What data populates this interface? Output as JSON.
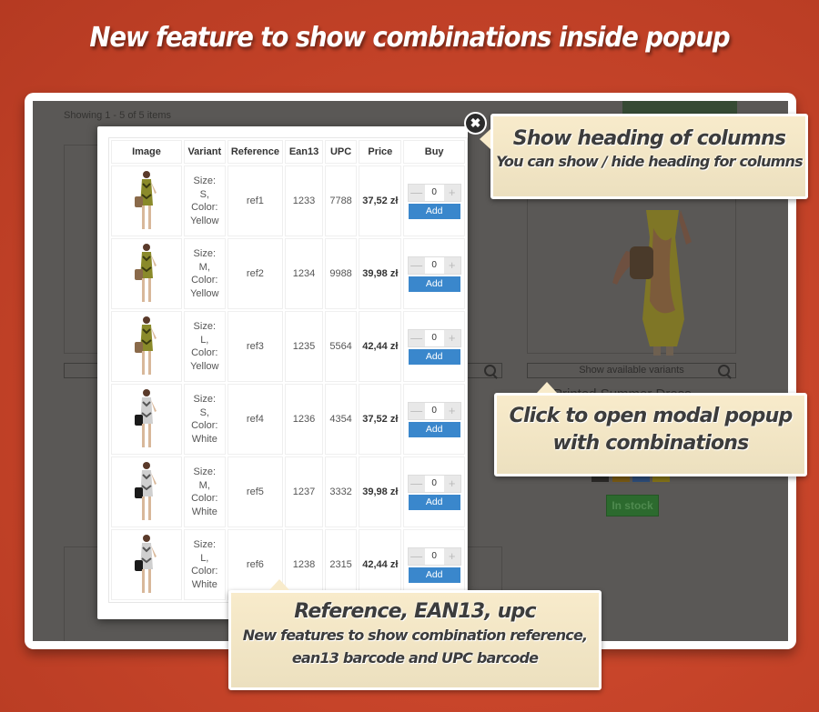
{
  "headline": "New feature to show combinations inside popup",
  "shop": {
    "showing_text": "Showing 1 - 5 of 5 items",
    "show_variants_label": "Show available variants",
    "product_name_partial": "Printed Summer Dress",
    "in_stock_label": "In stock",
    "swatch_colors": [
      "#2b2a28",
      "#7a5a14",
      "#2d4d7a",
      "#857417"
    ]
  },
  "modal": {
    "close_icon": "close-icon",
    "columns": [
      "Image",
      "Variant",
      "Reference",
      "Ean13",
      "UPC",
      "Price",
      "Buy"
    ],
    "add_label": "Add",
    "rows": [
      {
        "size_label": "Size:",
        "size": "S,",
        "color_label": "Color:",
        "color": "Yellow",
        "reference": "ref1",
        "ean13": "1233",
        "upc": "7788",
        "price": "37,52 zł",
        "qty": "0",
        "dress_color": "yellow"
      },
      {
        "size_label": "Size:",
        "size": "M,",
        "color_label": "Color:",
        "color": "Yellow",
        "reference": "ref2",
        "ean13": "1234",
        "upc": "9988",
        "price": "39,98 zł",
        "qty": "0",
        "dress_color": "yellow"
      },
      {
        "size_label": "Size:",
        "size": "L,",
        "color_label": "Color:",
        "color": "Yellow",
        "reference": "ref3",
        "ean13": "1235",
        "upc": "5564",
        "price": "42,44 zł",
        "qty": "0",
        "dress_color": "yellow"
      },
      {
        "size_label": "Size:",
        "size": "S,",
        "color_label": "Color:",
        "color": "White",
        "reference": "ref4",
        "ean13": "1236",
        "upc": "4354",
        "price": "37,52 zł",
        "qty": "0",
        "dress_color": "white"
      },
      {
        "size_label": "Size:",
        "size": "M,",
        "color_label": "Color:",
        "color": "White",
        "reference": "ref5",
        "ean13": "1237",
        "upc": "3332",
        "price": "39,98 zł",
        "qty": "0",
        "dress_color": "white"
      },
      {
        "size_label": "Size:",
        "size": "L,",
        "color_label": "Color:",
        "color": "White",
        "reference": "ref6",
        "ean13": "1238",
        "upc": "2315",
        "price": "42,44 zł",
        "qty": "0",
        "dress_color": "white"
      }
    ]
  },
  "callouts": {
    "heading": {
      "title": "Show heading of columns",
      "subtitle": "You can show / hide heading for columns"
    },
    "modal": {
      "line1": "Click to open modal popup",
      "line2": "with combinations"
    },
    "reference": {
      "title": "Reference, EAN13, upc",
      "line1": "New features to show combination reference,",
      "line2": "ean13 barcode and UPC barcode"
    }
  }
}
